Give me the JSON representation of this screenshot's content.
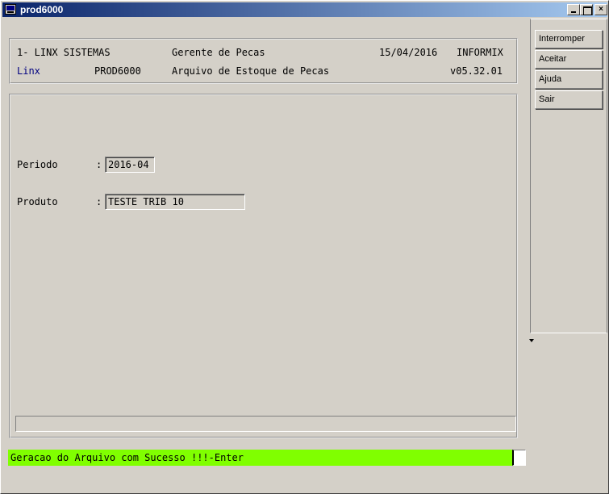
{
  "window": {
    "title": "prod6000",
    "minimize_label": "",
    "maximize_label": "",
    "close_label": "×"
  },
  "header": {
    "company": "1- LINX SISTEMAS",
    "module": "Gerente de Pecas",
    "date": "15/04/2016",
    "db": "INFORMIX",
    "brand": "Linx",
    "program": "PROD6000",
    "description": "Arquivo de Estoque de Pecas",
    "version": "v05.32.01"
  },
  "form": {
    "periodo_label": "Periodo",
    "periodo_colon": ":",
    "periodo_value": "2016-04",
    "produto_label": "Produto",
    "produto_colon": ":",
    "produto_value": "TESTE TRIB 10"
  },
  "side_buttons": {
    "interromper": "Interromper",
    "aceitar": "Aceitar",
    "ajuda": "Ajuda",
    "sair": "Sair"
  },
  "status": {
    "message": "Geracao do Arquivo com Sucesso !!!-Enter",
    "color": "#80ff00"
  }
}
